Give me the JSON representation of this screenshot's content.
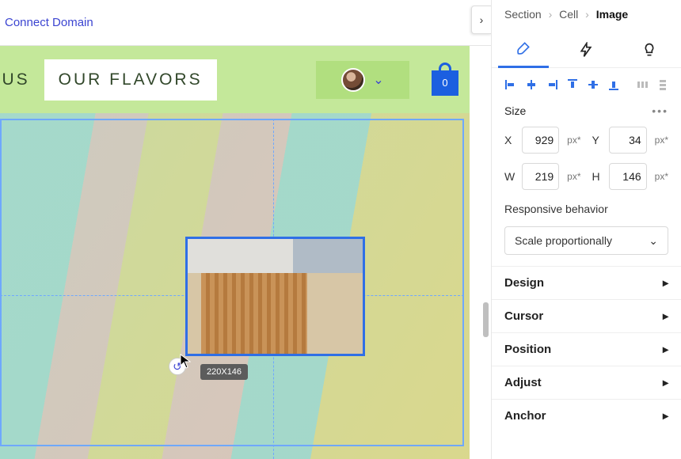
{
  "header": {
    "connect_domain": "Connect Domain"
  },
  "nav": {
    "item_about": "UT US",
    "item_flavors": "OUR FLAVORS",
    "cart_count": "0"
  },
  "selection": {
    "dim_badge": "220X146"
  },
  "breadcrumbs": {
    "a": "Section",
    "b": "Cell",
    "c": "Image",
    "sep": "›"
  },
  "size": {
    "label": "Size",
    "x_label": "X",
    "x_value": "929",
    "x_unit": "px*",
    "y_label": "Y",
    "y_value": "34",
    "y_unit": "px*",
    "w_label": "W",
    "w_value": "219",
    "w_unit": "px*",
    "h_label": "H",
    "h_value": "146",
    "h_unit": "px*"
  },
  "responsive": {
    "label": "Responsive behavior",
    "value": "Scale proportionally"
  },
  "accordion": {
    "design": "Design",
    "cursor": "Cursor",
    "position": "Position",
    "adjust": "Adjust",
    "anchor": "Anchor"
  },
  "icons": {
    "dots": "•••",
    "chev_down": "⌄",
    "chev_right": "›",
    "collapse": "›",
    "rotate": "↺"
  }
}
